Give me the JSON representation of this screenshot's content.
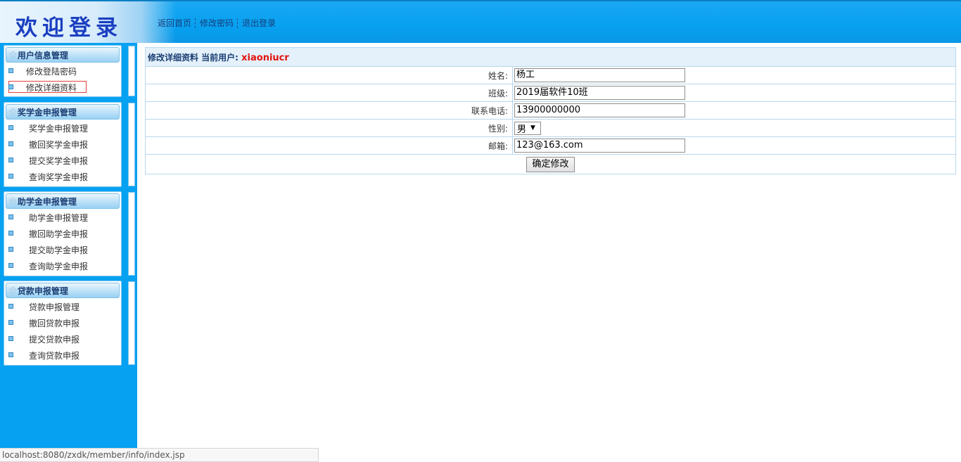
{
  "header": {
    "logo_text": "欢迎登录",
    "nav": [
      "返回首页",
      "修改密码",
      "退出登录"
    ]
  },
  "sidebar": {
    "groups": [
      {
        "title": "用户信息管理",
        "items": [
          "修改登陆密码",
          "修改详细资料"
        ],
        "selected": 1
      },
      {
        "title": "奖学金申报管理",
        "items": [
          "奖学金申报管理",
          "撤回奖学金申报",
          "提交奖学金申报",
          "查询奖学金申报"
        ]
      },
      {
        "title": "助学金申报管理",
        "items": [
          "助学金申报管理",
          "撤回助学金申报",
          "提交助学金申报",
          "查询助学金申报"
        ]
      },
      {
        "title": "贷款申报管理",
        "items": [
          "贷款申报管理",
          "撤回贷款申报",
          "提交贷款申报",
          "查询贷款申报"
        ]
      }
    ]
  },
  "form": {
    "heading": "修改详细资料 当前用户:",
    "current_user": "xiaoniucr",
    "fields": [
      {
        "label": "姓名:",
        "value": "杨工"
      },
      {
        "label": "班级:",
        "value": "2019届软件10班"
      },
      {
        "label": "联系电话:",
        "value": "13900000000"
      },
      {
        "label": "性别:",
        "value": "男"
      },
      {
        "label": "邮箱:",
        "value": "123@163.com"
      }
    ],
    "submit_label": "确定修改"
  },
  "status_url": "localhost:8080/zxdk/member/info/index.jsp",
  "colors": {
    "header_blue": "#07a0f0",
    "title_blue": "#1b3fc1",
    "user_red": "#e3120b"
  }
}
